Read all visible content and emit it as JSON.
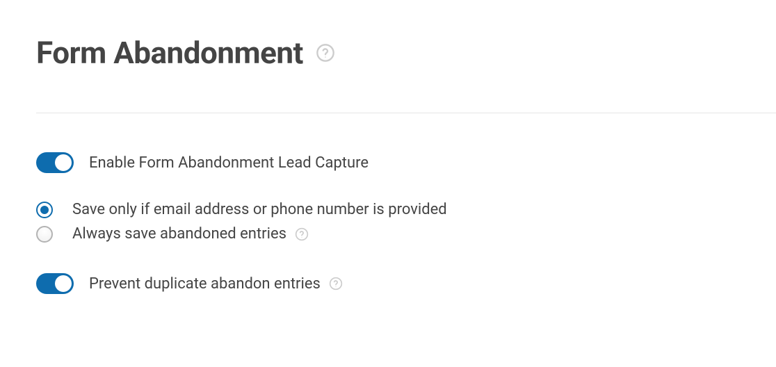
{
  "heading": "Form Abandonment",
  "options": {
    "enable": {
      "label": "Enable Form Abandonment Lead Capture",
      "checked": true
    },
    "radio_save_if": {
      "label": "Save only if email address or phone number is provided",
      "selected": true
    },
    "radio_always": {
      "label": "Always save abandoned entries",
      "selected": false
    },
    "prevent_dup": {
      "label": "Prevent duplicate abandon entries",
      "checked": true
    }
  },
  "colors": {
    "accent": "#0e6cae",
    "text": "#444444",
    "muted": "#cccccc",
    "divider": "#e5e5e5"
  }
}
